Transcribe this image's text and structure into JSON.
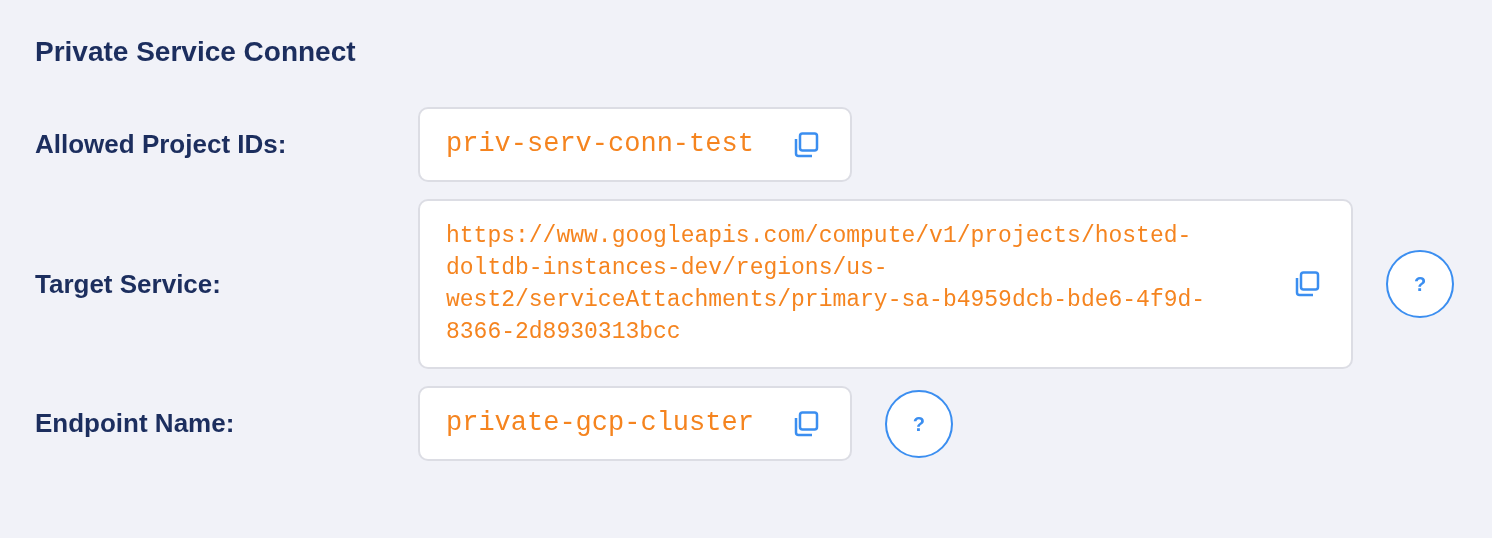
{
  "title": "Private Service Connect",
  "fields": [
    {
      "kind": "short",
      "label": "Allowed Project IDs:",
      "value": "priv-serv-conn-test"
    },
    {
      "kind": "long",
      "label": "Target Service:",
      "value": "https://www.googleapis.com/compute/v1/projects/hosted-doltdb-instances-dev/regions/us-west2/serviceAttachments/primary-sa-b4959dcb-bde6-4f9d-8366-2d8930313bcc",
      "help": "?"
    },
    {
      "kind": "short",
      "label": "Endpoint Name:",
      "value": "private-gcp-cluster",
      "help": "?"
    }
  ]
}
